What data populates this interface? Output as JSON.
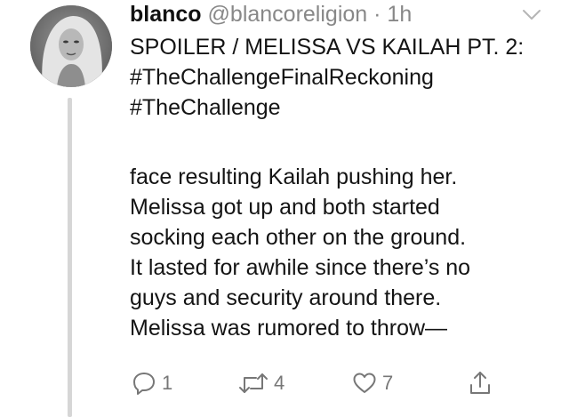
{
  "tweet": {
    "display_name": "blanco",
    "handle": "@blancoreligion",
    "separator": "·",
    "time": "1h",
    "title_text": "SPOILER / MELISSA VS KAILAH PT. 2: ",
    "hashtag_1": "#TheChallengeFinalReckoning",
    "hashtag_2": "#TheChallenge",
    "body_text": "face resulting Kailah pushing her.\nMelissa got up and both started\nsocking each other on the ground.\nIt lasted for awhile since there’s no\nguys and security around there.\nMelissa was rumored to throw—"
  },
  "actions": {
    "reply_count": "1",
    "retweet_count": "4",
    "like_count": "7"
  },
  "icons": {
    "caret": "chevron-down-icon",
    "reply": "reply-icon",
    "retweet": "retweet-icon",
    "like": "heart-icon",
    "share": "share-icon"
  },
  "colors": {
    "text": "#141414",
    "muted": "#888888",
    "thread_line": "#d6d6d6"
  }
}
